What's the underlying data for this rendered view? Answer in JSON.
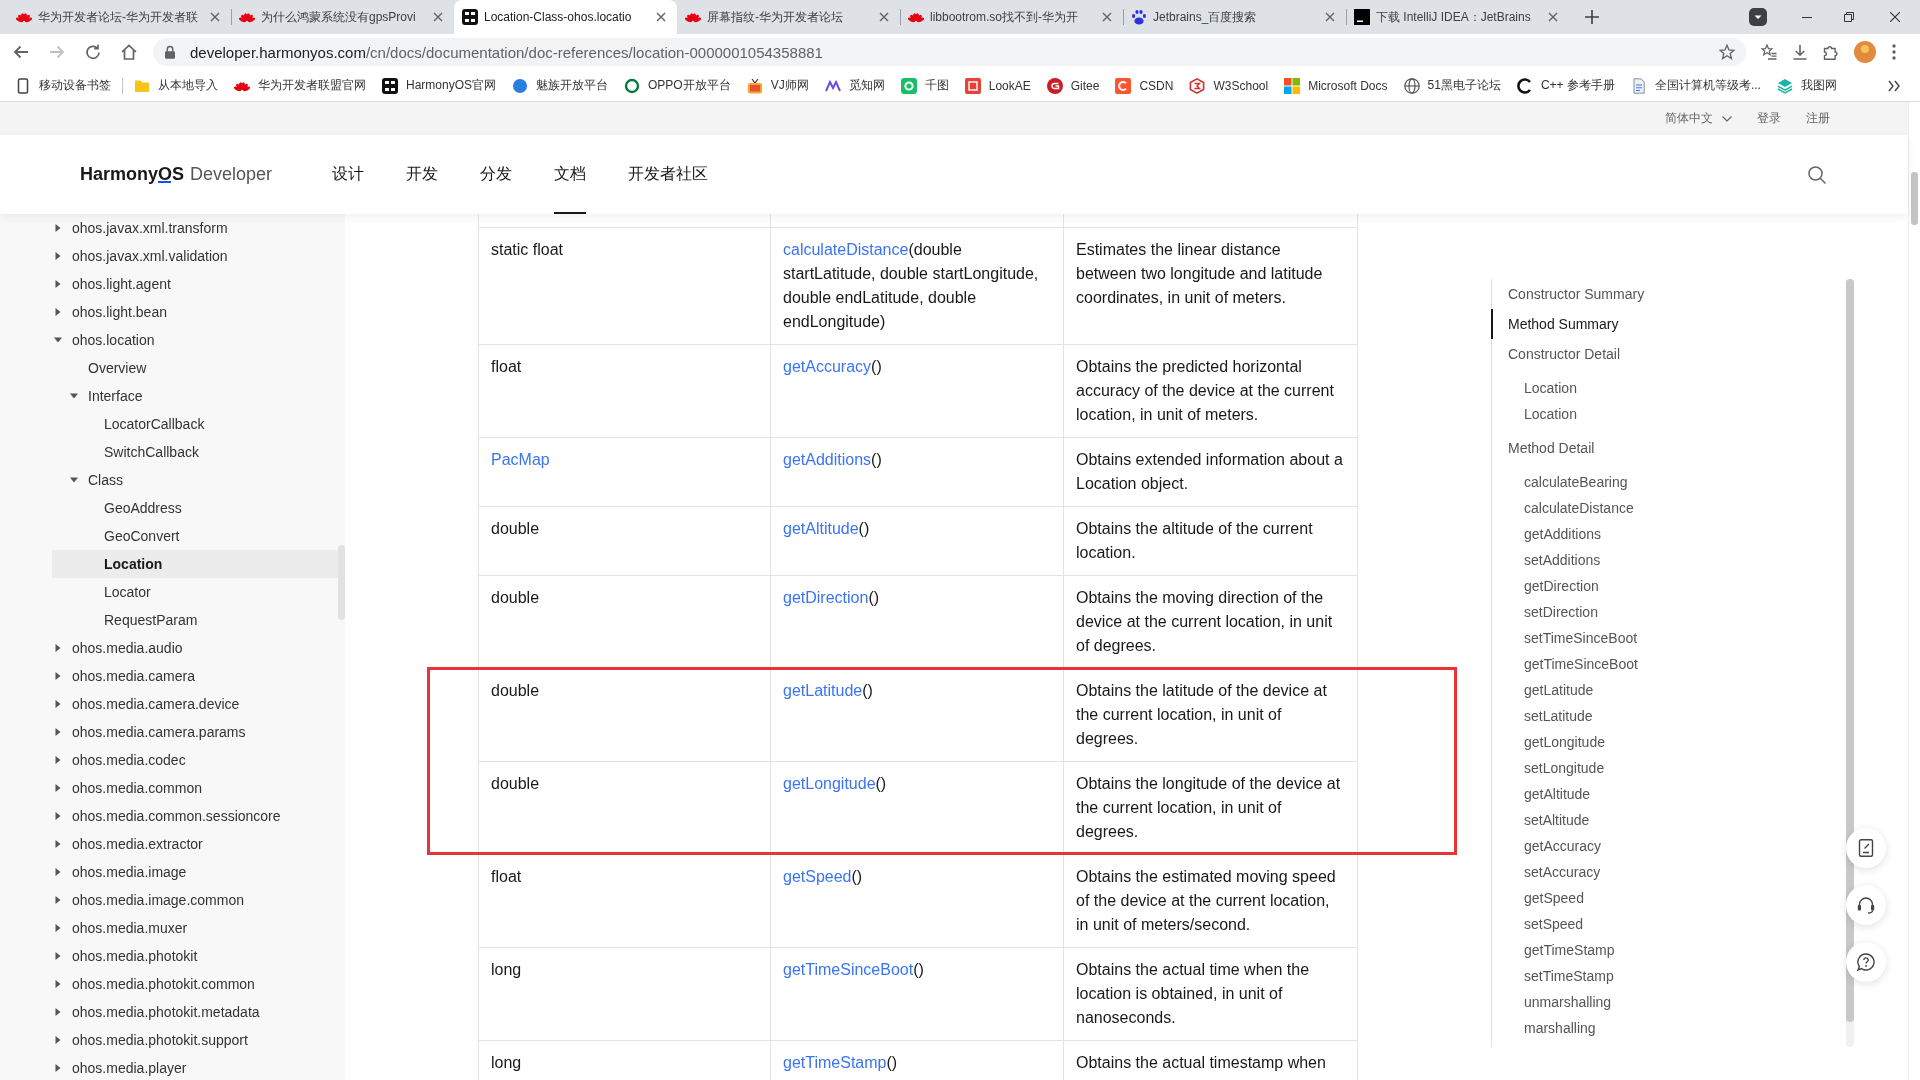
{
  "browser": {
    "tabs": [
      {
        "kind": "flower",
        "title": "华为开发者论坛-华为开发者联",
        "selected": false
      },
      {
        "kind": "flower",
        "title": "为什么鸿蒙系统没有gpsProvi",
        "selected": false
      },
      {
        "kind": "hm-tile",
        "title": "Location-Class-ohos.locatio",
        "selected": true
      },
      {
        "kind": "flower",
        "title": "屏幕指纹-华为开发者论坛",
        "selected": false
      },
      {
        "kind": "flower",
        "title": "libbootrom.so找不到-华为开",
        "selected": false
      },
      {
        "kind": "paw",
        "title": "Jetbrains_百度搜索",
        "selected": false
      },
      {
        "kind": "jb-tile",
        "title": "下载 IntelliJ IDEA：JetBrains",
        "selected": false
      }
    ],
    "url": "developer.harmonyos.com/cn/docs/documentation/doc-references/location-0000001054358881",
    "bookmarks": [
      {
        "kind": "phone",
        "label": "移动设备书签"
      },
      {
        "kind": "folder",
        "label": "从本地导入"
      },
      {
        "kind": "flower",
        "label": "华为开发者联盟官网"
      },
      {
        "kind": "hm-tile",
        "label": "HarmonyOS官网"
      },
      {
        "kind": "dot",
        "label": "魅族开放平台"
      },
      {
        "kind": "ring",
        "label": "OPPO开放平台"
      },
      {
        "kind": "tv",
        "label": "VJ师网"
      },
      {
        "kind": "zigzag",
        "label": "觅知网"
      },
      {
        "kind": "q-square",
        "label": "千图"
      },
      {
        "kind": "face-square",
        "label": "LookAE"
      },
      {
        "kind": "g-circle",
        "label": "Gitee"
      },
      {
        "kind": "c-square",
        "label": "CSDN"
      },
      {
        "kind": "shield",
        "label": "W3School"
      },
      {
        "kind": "grid",
        "label": "Microsoft Docs"
      },
      {
        "kind": "globe",
        "label": "51黑电子论坛"
      },
      {
        "kind": "c-circle",
        "label": "C++ 参考手册"
      },
      {
        "kind": "document",
        "label": "全国计算机等级考..."
      },
      {
        "kind": "layers",
        "label": "我图网"
      }
    ]
  },
  "site_bar": {
    "language": "简体中文",
    "login": "登录",
    "register": "注册"
  },
  "header": {
    "logo_brand": "HarmonyOS",
    "logo_product": "Developer",
    "nav": [
      {
        "label": "设计",
        "selected": false
      },
      {
        "label": "开发",
        "selected": false
      },
      {
        "label": "分发",
        "selected": false
      },
      {
        "label": "文档",
        "selected": true
      },
      {
        "label": "开发者社区",
        "selected": false
      }
    ]
  },
  "sidebar": {
    "items": [
      {
        "label": "ohos.javax.xml.transform",
        "kind": "group",
        "expanded": false,
        "selected": false
      },
      {
        "label": "ohos.javax.xml.validation",
        "kind": "group",
        "expanded": false,
        "selected": false
      },
      {
        "label": "ohos.light.agent",
        "kind": "group",
        "expanded": false,
        "selected": false
      },
      {
        "label": "ohos.light.bean",
        "kind": "group",
        "expanded": false,
        "selected": false
      },
      {
        "label": "ohos.location",
        "kind": "group",
        "expanded": true,
        "selected": false,
        "children": [
          {
            "label": "Overview",
            "kind": "page",
            "selected": false
          },
          {
            "label": "Interface",
            "kind": "group",
            "expanded": true,
            "selected": false,
            "children": [
              {
                "label": "LocatorCallback",
                "kind": "page",
                "selected": false
              },
              {
                "label": "SwitchCallback",
                "kind": "page",
                "selected": false
              }
            ]
          },
          {
            "label": "Class",
            "kind": "group",
            "expanded": true,
            "selected": false,
            "children": [
              {
                "label": "GeoAddress",
                "kind": "page",
                "selected": false
              },
              {
                "label": "GeoConvert",
                "kind": "page",
                "selected": false
              },
              {
                "label": "Location",
                "kind": "page",
                "selected": true
              },
              {
                "label": "Locator",
                "kind": "page",
                "selected": false
              },
              {
                "label": "RequestParam",
                "kind": "page",
                "selected": false
              }
            ]
          }
        ]
      },
      {
        "label": "ohos.media.audio",
        "kind": "group",
        "expanded": false,
        "selected": false
      },
      {
        "label": "ohos.media.camera",
        "kind": "group",
        "expanded": false,
        "selected": false
      },
      {
        "label": "ohos.media.camera.device",
        "kind": "group",
        "expanded": false,
        "selected": false
      },
      {
        "label": "ohos.media.camera.params",
        "kind": "group",
        "expanded": false,
        "selected": false
      },
      {
        "label": "ohos.media.codec",
        "kind": "group",
        "expanded": false,
        "selected": false
      },
      {
        "label": "ohos.media.common",
        "kind": "group",
        "expanded": false,
        "selected": false
      },
      {
        "label": "ohos.media.common.sessioncore",
        "kind": "group",
        "expanded": false,
        "selected": false
      },
      {
        "label": "ohos.media.extractor",
        "kind": "group",
        "expanded": false,
        "selected": false
      },
      {
        "label": "ohos.media.image",
        "kind": "group",
        "expanded": false,
        "selected": false
      },
      {
        "label": "ohos.media.image.common",
        "kind": "group",
        "expanded": false,
        "selected": false
      },
      {
        "label": "ohos.media.muxer",
        "kind": "group",
        "expanded": false,
        "selected": false
      },
      {
        "label": "ohos.media.photokit",
        "kind": "group",
        "expanded": false,
        "selected": false
      },
      {
        "label": "ohos.media.photokit.common",
        "kind": "group",
        "expanded": false,
        "selected": false
      },
      {
        "label": "ohos.media.photokit.metadata",
        "kind": "group",
        "expanded": false,
        "selected": false
      },
      {
        "label": "ohos.media.photokit.support",
        "kind": "group",
        "expanded": false,
        "selected": false
      },
      {
        "label": "ohos.media.player",
        "kind": "group",
        "expanded": false,
        "selected": false
      }
    ]
  },
  "table": {
    "rows": [
      {
        "type": "static float",
        "type_link": false,
        "method": "calculateDistance",
        "params": "(double startLatitude, double startLongitude, double endLatitude, double endLongitude)",
        "description": "Estimates the linear distance between two longitude and latitude coordinates, in unit of meters.",
        "highlighted": false
      },
      {
        "type": "float",
        "type_link": false,
        "method": "getAccuracy",
        "params": "()",
        "description": "Obtains the predicted horizontal accuracy of the device at the current location, in unit of meters.",
        "highlighted": false
      },
      {
        "type": "PacMap",
        "type_link": true,
        "method": "getAdditions",
        "params": "()",
        "description": "Obtains extended information about a Location object.",
        "highlighted": false
      },
      {
        "type": "double",
        "type_link": false,
        "method": "getAltitude",
        "params": "()",
        "description": "Obtains the altitude of the current location.",
        "highlighted": false
      },
      {
        "type": "double",
        "type_link": false,
        "method": "getDirection",
        "params": "()",
        "description": "Obtains the moving direction of the device at the current location, in unit of degrees.",
        "highlighted": false
      },
      {
        "type": "double",
        "type_link": false,
        "method": "getLatitude",
        "params": "()",
        "description": "Obtains the latitude of the device at the current location, in unit of degrees.",
        "highlighted": true
      },
      {
        "type": "double",
        "type_link": false,
        "method": "getLongitude",
        "params": "()",
        "description": "Obtains the longitude of the device at the current location, in unit of degrees.",
        "highlighted": true
      },
      {
        "type": "float",
        "type_link": false,
        "method": "getSpeed",
        "params": "()",
        "description": "Obtains the estimated moving speed of the device at the current location, in unit of meters/second.",
        "highlighted": false
      },
      {
        "type": "long",
        "type_link": false,
        "method": "getTimeSinceBoot",
        "params": "()",
        "description": "Obtains the actual time when the location is obtained, in unit of nanoseconds.",
        "highlighted": false
      },
      {
        "type": "long",
        "type_link": false,
        "method": "getTimeStamp",
        "params": "()",
        "description": "Obtains the actual timestamp when",
        "highlighted": false
      }
    ]
  },
  "toc": {
    "items": [
      {
        "label": "Constructor Summary",
        "selected": false
      },
      {
        "label": "Method Summary",
        "selected": true
      },
      {
        "label": "Constructor Detail",
        "selected": false,
        "children": [
          {
            "label": "Location",
            "selected": false
          },
          {
            "label": "Location",
            "selected": false
          }
        ]
      },
      {
        "label": "Method Detail",
        "selected": false,
        "children": [
          {
            "label": "calculateBearing",
            "selected": false
          },
          {
            "label": "calculateDistance",
            "selected": false
          },
          {
            "label": "getAdditions",
            "selected": false
          },
          {
            "label": "setAdditions",
            "selected": false
          },
          {
            "label": "getDirection",
            "selected": false
          },
          {
            "label": "setDirection",
            "selected": false
          },
          {
            "label": "setTimeSinceBoot",
            "selected": false
          },
          {
            "label": "getTimeSinceBoot",
            "selected": false
          },
          {
            "label": "getLatitude",
            "selected": false
          },
          {
            "label": "setLatitude",
            "selected": false
          },
          {
            "label": "getLongitude",
            "selected": false
          },
          {
            "label": "setLongitude",
            "selected": false
          },
          {
            "label": "getAltitude",
            "selected": false
          },
          {
            "label": "setAltitude",
            "selected": false
          },
          {
            "label": "getAccuracy",
            "selected": false
          },
          {
            "label": "setAccuracy",
            "selected": false
          },
          {
            "label": "getSpeed",
            "selected": false
          },
          {
            "label": "setSpeed",
            "selected": false
          },
          {
            "label": "getTimeStamp",
            "selected": false
          },
          {
            "label": "setTimeStamp",
            "selected": false
          },
          {
            "label": "unmarshalling",
            "selected": false
          },
          {
            "label": "marshalling",
            "selected": false
          }
        ]
      }
    ]
  }
}
